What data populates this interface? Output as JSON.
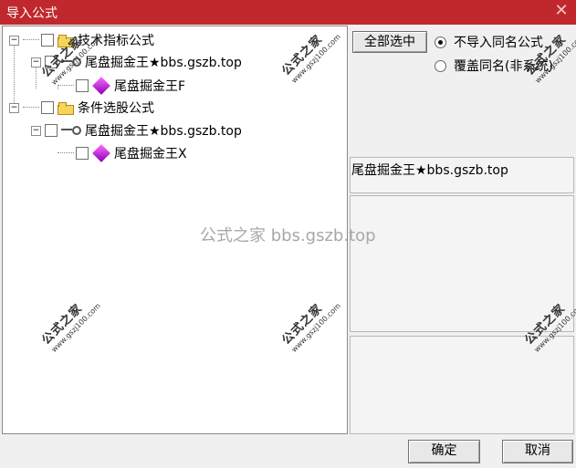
{
  "window": {
    "title": "导入公式",
    "close_icon": "close-icon"
  },
  "tree": {
    "root1": "技术指标公式",
    "item1": "尾盘掘金王★bbs.gszb.top",
    "item1_child": "尾盘掘金王F",
    "root2": "条件选股公式",
    "item2": "尾盘掘金王★bbs.gszb.top",
    "item2_child": "尾盘掘金王X"
  },
  "buttons": {
    "select_all": "全部选中",
    "ok": "确定",
    "cancel": "取消"
  },
  "options": {
    "skip_same": "不导入同名公式",
    "overwrite": "覆盖同名(非系统)"
  },
  "info": {
    "formula_name": "尾盘掘金王★bbs.gszb.top"
  },
  "watermarks": {
    "center": "公式之家 bbs.gszb.top",
    "brand": "公式之家",
    "url": "www.gszj100.com"
  }
}
